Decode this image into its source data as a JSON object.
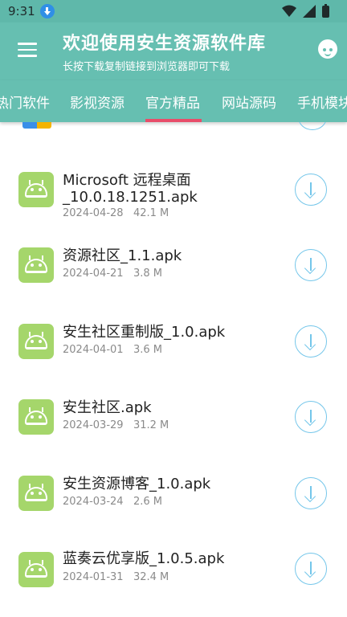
{
  "status_bar": {
    "time": "9:31"
  },
  "app_bar": {
    "title": "欢迎使用安生资源软件库",
    "subtitle": "长按下载复制链接到浏览器即可下载"
  },
  "tabs": [
    {
      "label": "热门软件"
    },
    {
      "label": "影视资源"
    },
    {
      "label": "官方精品",
      "active": true
    },
    {
      "label": "网站源码"
    },
    {
      "label": "手机模块"
    }
  ],
  "colors": {
    "accent": "#66bfb1",
    "tab_indicator": "#e84d6a",
    "apk_icon": "#a5d66b",
    "download_icon": "#74c6ea"
  },
  "files": [
    {
      "name": "Microsoft 远程桌面_10.0.18.1251.apk",
      "date": "2024-04-28",
      "size": "42.1 M"
    },
    {
      "name": "资源社区_1.1.apk",
      "date": "2024-04-21",
      "size": "3.8 M"
    },
    {
      "name": "安生社区重制版_1.0.apk",
      "date": "2024-04-01",
      "size": "3.6 M"
    },
    {
      "name": "安生社区.apk",
      "date": "2024-03-29",
      "size": "31.2 M"
    },
    {
      "name": "安生资源博客_1.0.apk",
      "date": "2024-03-24",
      "size": "2.6 M"
    },
    {
      "name": "蓝奏云优享版_1.0.5.apk",
      "date": "2024-01-31",
      "size": "32.4 M"
    }
  ],
  "file_meta": {
    "f0": "2024-04-28   42.1 M",
    "f1": "2024-04-21   3.8 M",
    "f2": "2024-04-01   3.6 M",
    "f3": "2024-03-29   31.2 M",
    "f4": "2024-03-24   2.6 M",
    "f5": "2024-01-31   32.4 M"
  }
}
